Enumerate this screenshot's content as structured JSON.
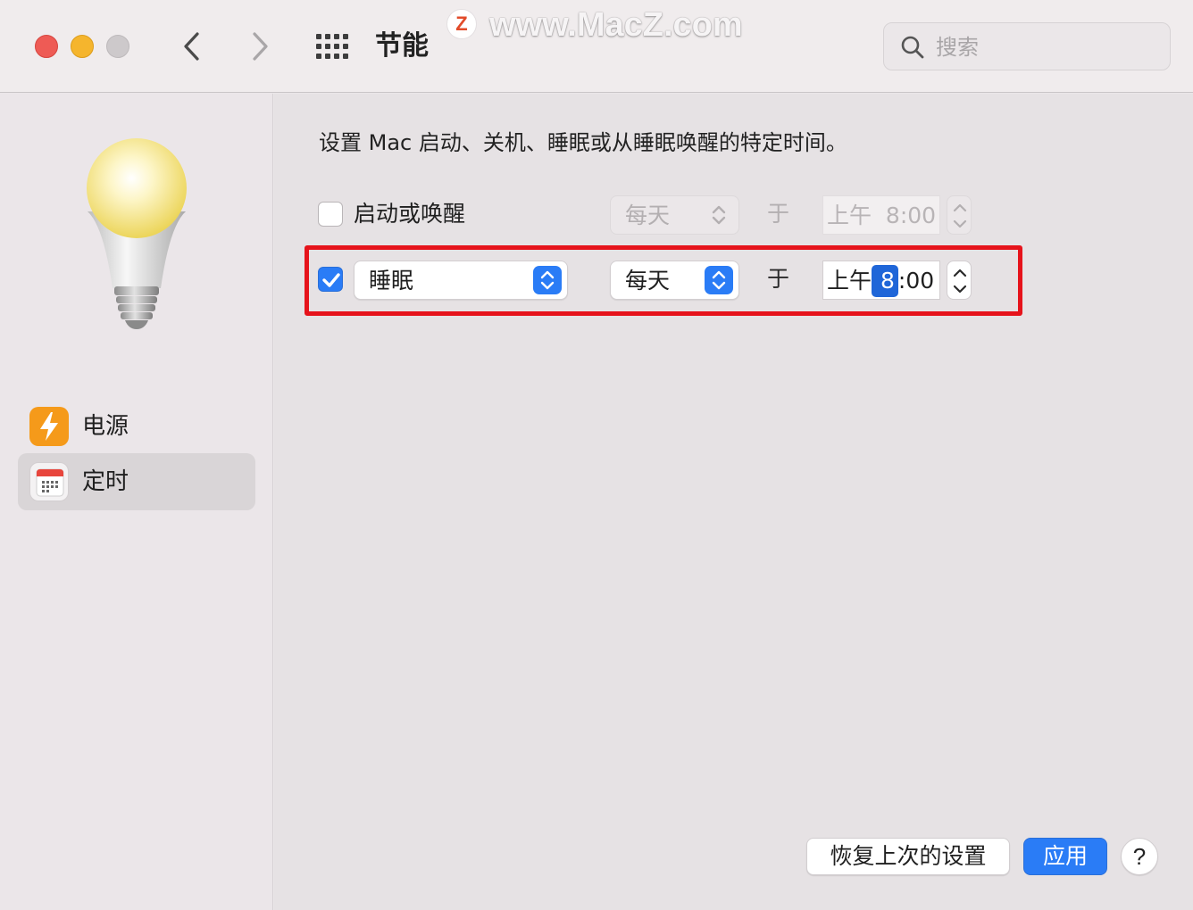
{
  "window": {
    "title": "节能",
    "watermark_logo": "Z",
    "watermark_text": "www.MacZ.com"
  },
  "search": {
    "placeholder": "搜索"
  },
  "sidebar": {
    "items": [
      {
        "label": "电源",
        "icon": "power-bolt-icon",
        "selected": false
      },
      {
        "label": "定时",
        "icon": "calendar-schedule-icon",
        "selected": true
      }
    ]
  },
  "main": {
    "description": "设置 Mac 启动、关机、睡眠或从睡眠唤醒的特定时间。",
    "startup_row": {
      "checked": false,
      "label": "启动或唤醒",
      "frequency": "每天",
      "at_label": "于",
      "time_period": "上午",
      "time": "8:00",
      "enabled": false
    },
    "sleep_row": {
      "checked": true,
      "action": "睡眠",
      "frequency": "每天",
      "at_label": "于",
      "time_period": "上午",
      "time_hour": "8",
      "time_rest": ":00",
      "enabled": true
    }
  },
  "buttons": {
    "revert": "恢复上次的设置",
    "apply": "应用",
    "help": "?"
  },
  "colors": {
    "accent": "#2a7cf6",
    "highlight_box": "#e6131b",
    "close": "#ee5b55",
    "minimize": "#f5b52d"
  }
}
